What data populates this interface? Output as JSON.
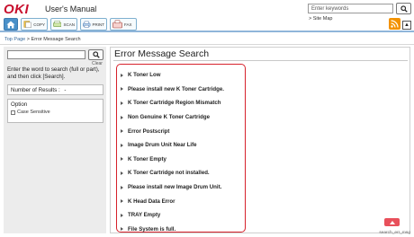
{
  "header": {
    "logo": "OKI",
    "title": "User's Manual",
    "nav": [
      {
        "icon": "home-icon",
        "label": ""
      },
      {
        "icon": "copy-icon",
        "label": "COPY"
      },
      {
        "icon": "scan-icon",
        "label": "SCAN"
      },
      {
        "icon": "print-icon",
        "label": "PRINT"
      },
      {
        "icon": "fax-icon",
        "label": "FAX"
      }
    ],
    "search_placeholder": "Enter keywords",
    "site_map": "> Site Map"
  },
  "breadcrumb": {
    "home": "Top Page",
    "sep": ">",
    "current": "Error Message Search"
  },
  "sidebar": {
    "clear": "Clear",
    "instruction": "Enter the word to search (full or part), and then click [Search].",
    "results_label": "Number of Results :",
    "results_value": "-",
    "option_title": "Option",
    "case_sensitive": "Case Sensitive"
  },
  "main": {
    "title": "Error Message Search",
    "items": [
      "K Toner Low",
      "Please install new K Toner Cartridge.",
      "K Toner Cartridge Region Mismatch",
      "Non Genuine K Toner Cartridge",
      "Error Postscript",
      "Image Drum Unit Near Life",
      "K Toner Empty",
      "K Toner Cartridge not installed.",
      "Please install new Image Drum Unit.",
      "K Head Data Error",
      "TRAY Empty",
      "File System is full."
    ]
  },
  "page_id": "search_err_msg",
  "colors": {
    "brand": "#c8102e",
    "highlight_border": "#d6212b",
    "rss": "#f39200",
    "top_button": "#e8505b"
  }
}
